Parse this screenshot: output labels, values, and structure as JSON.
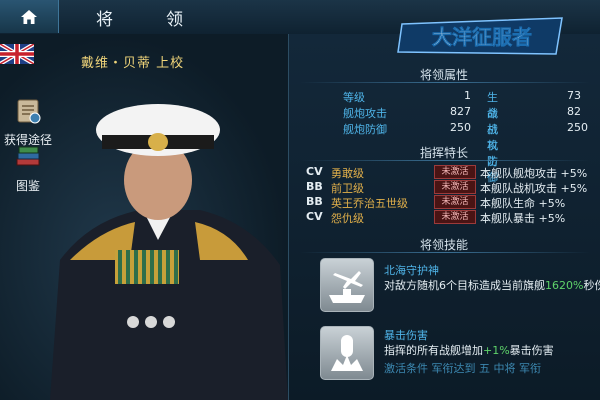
{
  "header": {
    "title": "将　领",
    "home_icon": "home-icon"
  },
  "logo": {
    "text": "大洋征服者"
  },
  "commander": {
    "name": "戴维・贝蒂 上校",
    "flag_icon": "union-jack-flag-icon"
  },
  "side_buttons": [
    {
      "label": "获得途径",
      "icon": "map-scroll-icon"
    },
    {
      "label": "图鉴",
      "icon": "books-icon"
    }
  ],
  "attributes": {
    "title": "将领属性",
    "rows": [
      {
        "l1": "等级",
        "v1": "1",
        "l2": "生命",
        "v2": "73"
      },
      {
        "l1": "舰炮攻击",
        "v1": "827",
        "l2": "战机攻击",
        "v2": "82"
      },
      {
        "l1": "舰炮防御",
        "v1": "250",
        "l2": "战机防御",
        "v2": "250"
      }
    ]
  },
  "specialties": {
    "title": "指挥特长",
    "items": [
      {
        "type": "CV",
        "name": "勇敢级",
        "status": "未激活",
        "desc": "本舰队舰炮攻击 +5%"
      },
      {
        "type": "BB",
        "name": "前卫级",
        "status": "未激活",
        "desc": "本舰队战机攻击 +5%"
      },
      {
        "type": "BB",
        "name": "英王乔治五世级",
        "status": "未激活",
        "desc": "本舰队生命 +5%"
      },
      {
        "type": "CV",
        "name": "怨仇级",
        "status": "未激活",
        "desc": "本舰队暴击 +5%"
      }
    ]
  },
  "skills": {
    "title": "将领技能",
    "items": [
      {
        "name": "北海守护神",
        "desc_before": "对敌方随机6个目标造成当前旗舰",
        "highlight": "1620%",
        "desc_after": "秒伤的伤",
        "icon": "aircraft-fleet-icon"
      },
      {
        "name": "暴击伤害",
        "desc_before": "指挥的所有战舰增加",
        "highlight": "+1%",
        "desc_after": "暴击伤害",
        "icon": "bomb-blast-icon"
      }
    ],
    "partial_line": "激活条件 军衔达到 五 中将 军衔"
  },
  "colors": {
    "accent_blue": "#4fb4e8",
    "gold": "#f0d57a",
    "highlight_green": "#5fd36a",
    "inactive_red": "#9c3a3a"
  }
}
